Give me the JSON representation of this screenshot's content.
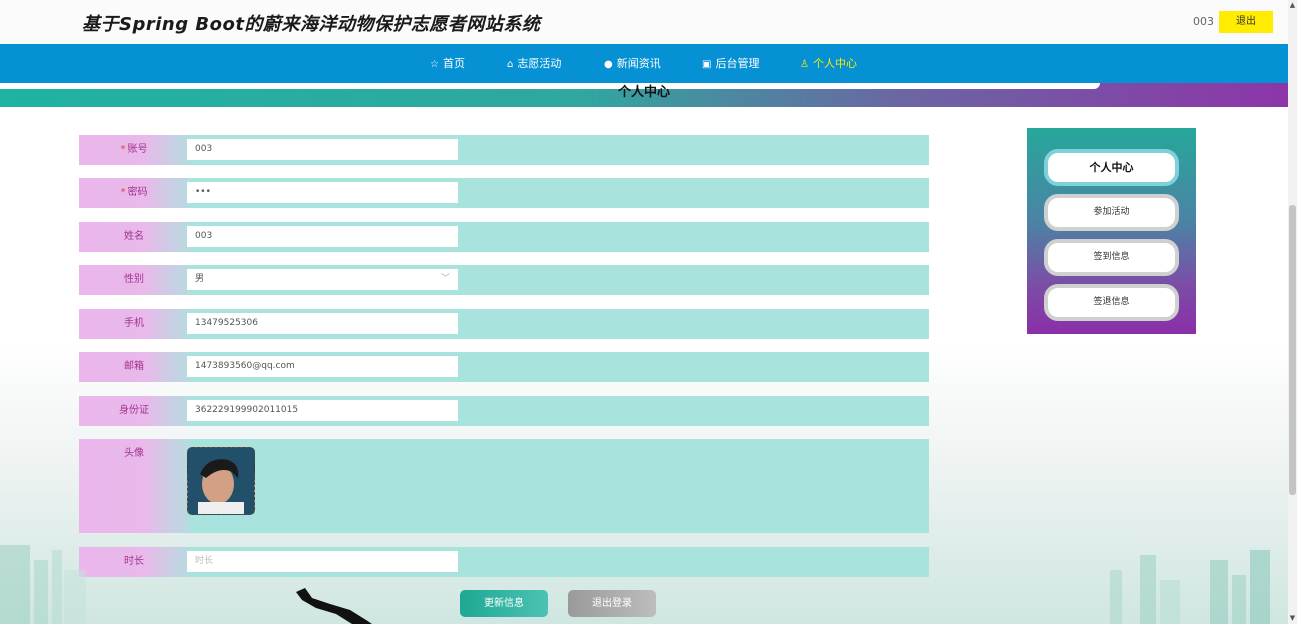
{
  "header": {
    "title": "基于Spring Boot的蔚来海洋动物保护志愿者网站系统",
    "username": "003",
    "logout_label": "退出"
  },
  "nav": {
    "items": [
      {
        "label": "首页",
        "icon": "star-icon",
        "active": false
      },
      {
        "label": "志愿活动",
        "icon": "bag-icon",
        "active": false
      },
      {
        "label": "新闻资讯",
        "icon": "info-icon",
        "active": false
      },
      {
        "label": "后台管理",
        "icon": "briefcase-icon",
        "active": false
      },
      {
        "label": "个人中心",
        "icon": "user-icon",
        "active": true
      }
    ]
  },
  "page_heading": "个人中心",
  "form": {
    "fields": [
      {
        "label": "账号",
        "required": true,
        "value": "003"
      },
      {
        "label": "密码",
        "required": true,
        "value": "•••"
      },
      {
        "label": "姓名",
        "required": false,
        "value": "003"
      },
      {
        "label": "性别",
        "required": false,
        "value": "男"
      },
      {
        "label": "手机",
        "required": false,
        "value": "13479525306"
      },
      {
        "label": "邮箱",
        "required": false,
        "value": "1473893560@qq.com"
      },
      {
        "label": "身份证",
        "required": false,
        "value": "362229199902011015"
      }
    ],
    "avatar_label": "头像",
    "duration_label": "时长",
    "duration_placeholder": "时长",
    "required_mark": "*",
    "select_arrow": "﹀"
  },
  "buttons": {
    "update": "更新信息",
    "logout": "退出登录"
  },
  "sidebar": {
    "items": [
      {
        "label": "个人中心",
        "active": true
      },
      {
        "label": "参加活动",
        "active": false
      },
      {
        "label": "签到信息",
        "active": false
      },
      {
        "label": "签退信息",
        "active": false
      }
    ]
  },
  "colors": {
    "nav_bg": "#0591d4",
    "active_nav": "#ffec00",
    "row_bg": "#a8e3de",
    "label_bg": "#ebb6ec",
    "label_text": "#a2338f"
  }
}
